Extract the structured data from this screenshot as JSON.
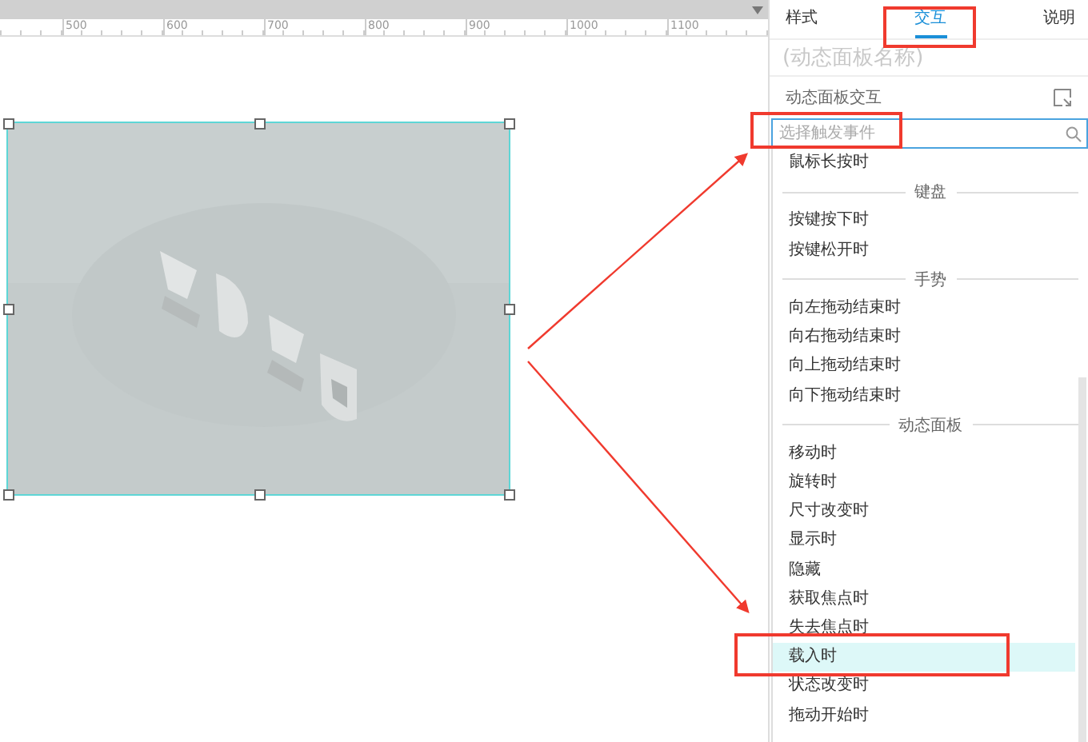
{
  "ruler": {
    "ticks": [
      "500",
      "600",
      "700",
      "800",
      "900",
      "1000",
      "1100"
    ]
  },
  "panel": {
    "tabs": [
      {
        "label": "样式",
        "selected": false
      },
      {
        "label": "交互",
        "selected": true
      },
      {
        "label": "说明",
        "selected": false
      }
    ],
    "name_field": {
      "placeholder": "(动态面板名称)"
    },
    "section_label": "动态面板交互",
    "event_search": {
      "placeholder": "选择触发事件"
    },
    "events": [
      {
        "kind": "item",
        "label": "鼠标长按时",
        "selected": false
      },
      {
        "kind": "group",
        "label": "键盘"
      },
      {
        "kind": "item",
        "label": "按键按下时",
        "selected": false
      },
      {
        "kind": "item",
        "label": "按键松开时",
        "selected": false
      },
      {
        "kind": "group",
        "label": "手势"
      },
      {
        "kind": "item",
        "label": "向左拖动结束时",
        "selected": false
      },
      {
        "kind": "item",
        "label": "向右拖动结束时",
        "selected": false
      },
      {
        "kind": "item",
        "label": "向上拖动结束时",
        "selected": false
      },
      {
        "kind": "item",
        "label": "向下拖动结束时",
        "selected": false
      },
      {
        "kind": "group",
        "label": "动态面板"
      },
      {
        "kind": "item",
        "label": "移动时",
        "selected": false
      },
      {
        "kind": "item",
        "label": "旋转时",
        "selected": false
      },
      {
        "kind": "item",
        "label": "尺寸改变时",
        "selected": false
      },
      {
        "kind": "item",
        "label": "显示时",
        "selected": false
      },
      {
        "kind": "item",
        "label": "隐藏",
        "selected": false
      },
      {
        "kind": "item",
        "label": "获取焦点时",
        "selected": false
      },
      {
        "kind": "item",
        "label": "失去焦点时",
        "selected": false
      },
      {
        "kind": "item",
        "label": "载入时",
        "selected": true
      },
      {
        "kind": "item",
        "label": "状态改变时",
        "selected": false
      },
      {
        "kind": "item",
        "label": "拖动开始时",
        "selected": false
      }
    ]
  }
}
